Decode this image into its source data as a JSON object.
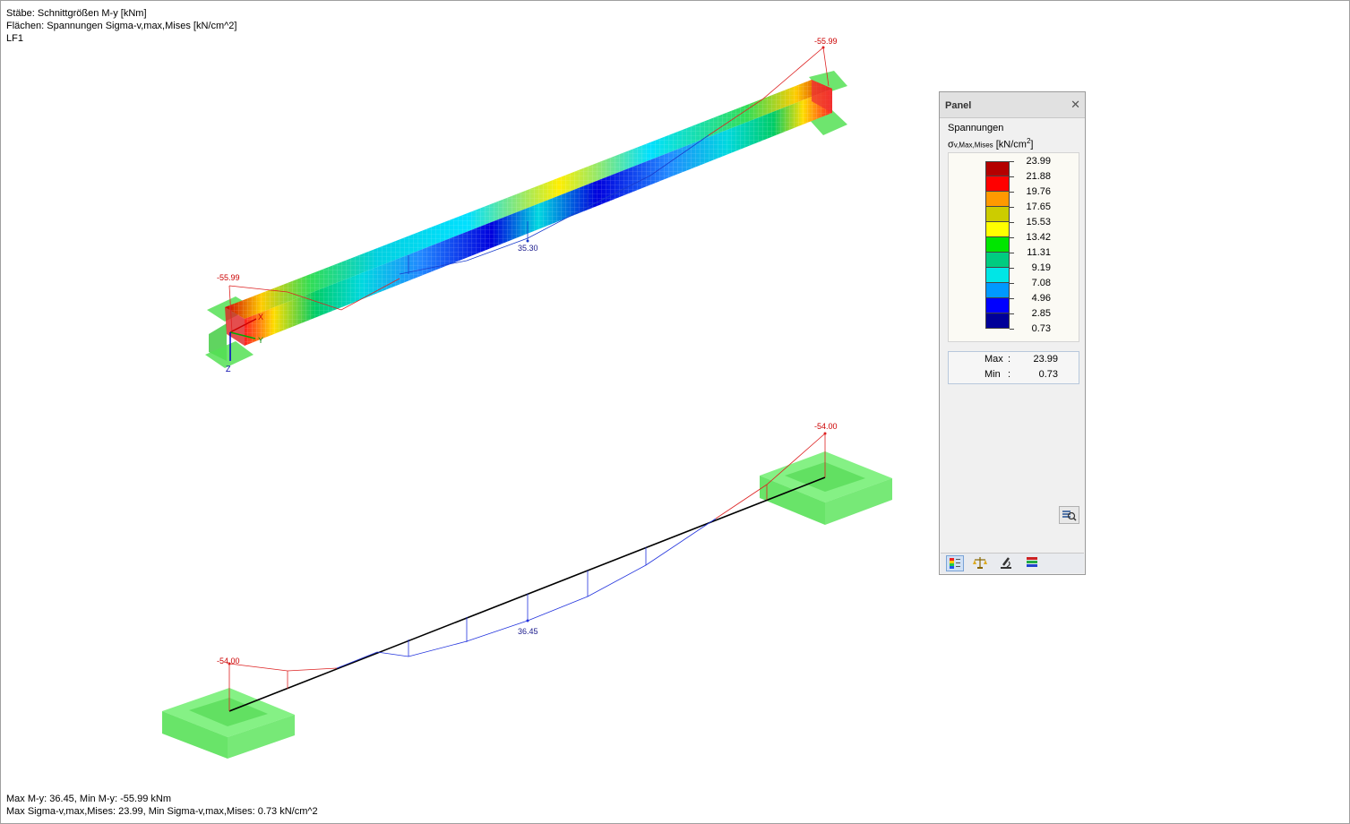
{
  "info_top": {
    "line1": "Stäbe: Schnittgrößen M-y [kNm]",
    "line2": "Flächen: Spannungen Sigma-v,max,Mises [kN/cm^2]",
    "line3": "LF1"
  },
  "info_bottom": {
    "line1": "Max M-y: 36.45, Min M-y: -55.99 kNm",
    "line2": "Max Sigma-v,max,Mises: 23.99, Min Sigma-v,max,Mises: 0.73 kN/cm^2"
  },
  "model_labels": {
    "beam_top_right_moment": "-55.99",
    "beam_top_left_moment": "-55.99",
    "beam_top_mid_moment": "35.30",
    "beam_bottom_right_moment": "-54.00",
    "beam_bottom_left_moment": "-54.00",
    "beam_bottom_mid_moment": "36.45",
    "axis_x": "X",
    "axis_y": "Y",
    "axis_z": "Z"
  },
  "panel": {
    "title": "Panel",
    "close_icon": "close-icon",
    "section_label": "Spannungen",
    "unit_symbol": "σ",
    "unit_subscript": "v,Max,Mises",
    "unit": "[kN/cm",
    "unit_exp": "2",
    "unit_close": "]",
    "legend": [
      {
        "value": "23.99",
        "color": "#b40000"
      },
      {
        "value": "21.88",
        "color": "#ff0000"
      },
      {
        "value": "19.76",
        "color": "#ff9900"
      },
      {
        "value": "17.65",
        "color": "#cccc00"
      },
      {
        "value": "15.53",
        "color": "#ffff00"
      },
      {
        "value": "13.42",
        "color": "#00e600"
      },
      {
        "value": "11.31",
        "color": "#00cc80"
      },
      {
        "value": "9.19",
        "color": "#00e6e6"
      },
      {
        "value": "7.08",
        "color": "#0099ff"
      },
      {
        "value": "4.96",
        "color": "#0000ff"
      },
      {
        "value": "2.85",
        "color": "#000099"
      }
    ],
    "legend_bottom_value": "0.73",
    "max_label": "Max",
    "max_value": "23.99",
    "min_label": "Min",
    "min_value": "0.73",
    "colon": ":",
    "toolbar_icons": [
      "color-scale-icon",
      "balance-icon",
      "microscope-icon",
      "layers-icon"
    ]
  }
}
